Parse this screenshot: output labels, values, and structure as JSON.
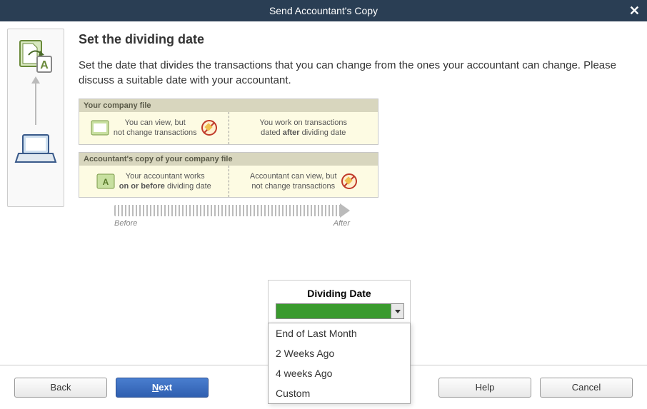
{
  "title": "Send Accountant's Copy",
  "heading": "Set the dividing date",
  "description": "Set the date that divides the transactions that you can change from the ones your accountant can change. Please discuss a suitable date with your accountant.",
  "diagram": {
    "section1": {
      "header": "Your company file",
      "left_line1": "You can view, but",
      "left_line2": "not change transactions",
      "right_line1": "You work on transactions",
      "right_line2_a": "dated ",
      "right_line2_b": "after",
      "right_line2_c": " dividing date"
    },
    "section2": {
      "header": "Accountant's copy of your company file",
      "left_line1": "Your accountant works",
      "left_line2_a": "on or before",
      "left_line2_b": " dividing date",
      "right_line1": "Accountant can view, but",
      "right_line2": "not change transactions"
    },
    "timeline": {
      "before": "Before",
      "after": "After"
    }
  },
  "dividing_date": {
    "label": "Dividing Date",
    "value": "",
    "options": [
      "End of Last Month",
      "2 Weeks Ago",
      "4 weeks Ago",
      "Custom"
    ]
  },
  "buttons": {
    "back": "Back",
    "next": "Next",
    "help": "Help",
    "cancel": "Cancel"
  }
}
